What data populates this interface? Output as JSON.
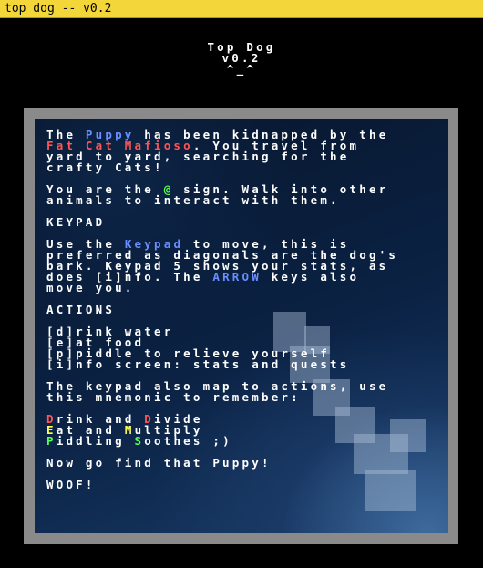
{
  "window": {
    "title": "top dog -- v0.2"
  },
  "header": {
    "title": "Top Dog",
    "version": "v0.2",
    "emoticon": "^_^"
  },
  "intro": {
    "l1_a": "The ",
    "l1_puppy": "Puppy",
    "l1_b": " has been kidnapped by the",
    "l2_mafioso": "Fat Cat Mafioso",
    "l2_b": ". You travel from",
    "l3": "yard to yard, searching for the",
    "l4": "crafty Cats!"
  },
  "sign": {
    "l1_a": "You are the ",
    "l1_at": "@",
    "l1_b": " sign. Walk into other",
    "l2": "animals to interact with them."
  },
  "keypad": {
    "heading": "KEYPAD",
    "l1_a": "Use the ",
    "l1_keypad": "Keypad",
    "l1_b": " to move, this is",
    "l2": "preferred as diagonals are the dog's",
    "l3": "bark. Keypad 5 shows your stats, as",
    "l4_a": "does [i]nfo. The ",
    "l4_arrow": "ARROW",
    "l4_b": " keys also",
    "l5": "move you."
  },
  "actions": {
    "heading": "ACTIONS",
    "items": [
      "[d]rink water",
      "[e]at food",
      "[p]piddle to relieve yourself",
      "[i]nfo screen: stats and quests"
    ],
    "map_l1": "The keypad also map to actions, use",
    "map_l2": "this mnemonic to remember:"
  },
  "mnemonic": {
    "l1_d1": "D",
    "l1_a": "rink and ",
    "l1_d2": "D",
    "l1_b": "ivide",
    "l2_e": "E",
    "l2_a": "at and ",
    "l2_m": "M",
    "l2_b": "ultiply",
    "l3_p": "P",
    "l3_a": "iddling ",
    "l3_s": "S",
    "l3_b": "oothes ;)"
  },
  "outro": {
    "find": "Now go find that Puppy!",
    "woof": "WOOF!"
  },
  "colors": {
    "titlebar": "#f2d63a",
    "frame": "#8a8a8a",
    "highlight_blue": "#6b8dff",
    "highlight_red": "#ff5555",
    "highlight_green": "#55ff55",
    "highlight_yellow": "#ffff55"
  }
}
